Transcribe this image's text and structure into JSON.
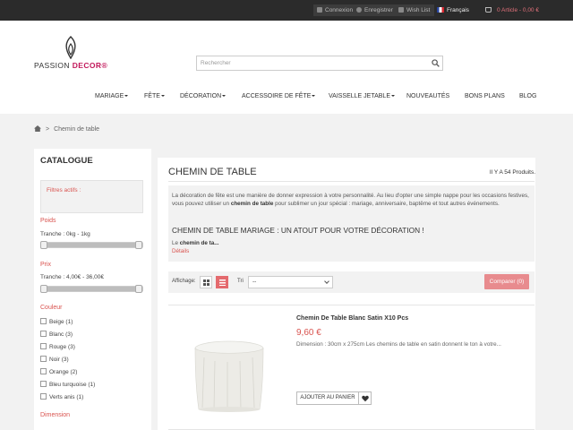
{
  "topbar": {
    "login": "Connexion",
    "register": "Enregistrer",
    "wishlist": "Wish List",
    "language": "Français",
    "cart": "0 Article - 0,00 €"
  },
  "logo": {
    "part1": "PASSION ",
    "part2": "DECOR",
    "mark": "®"
  },
  "search": {
    "placeholder": "Rechercher"
  },
  "nav": {
    "items": [
      {
        "label": "MARIAGE",
        "dropdown": true
      },
      {
        "label": "FÊTE",
        "dropdown": true
      },
      {
        "label": "DÉCORATION",
        "dropdown": true
      },
      {
        "label": "ACCESSOIRE DE FÊTE",
        "dropdown": true
      },
      {
        "label": "VAISSELLE JETABLE",
        "dropdown": true
      },
      {
        "label": "NOUVEAUTÉS",
        "dropdown": false
      },
      {
        "label": "BONS PLANS",
        "dropdown": false
      },
      {
        "label": "BLOG",
        "dropdown": false
      }
    ]
  },
  "breadcrumb": {
    "sep": ">",
    "current": "Chemin de table"
  },
  "sidebar": {
    "title": "CATALOGUE",
    "active_filters": "Filtres actifs :",
    "weight": {
      "label": "Poids",
      "range": "Tranche : 0kg - 1kg"
    },
    "price": {
      "label": "Prix",
      "range": "Tranche : 4,00€ - 36,00€"
    },
    "color": {
      "label": "Couleur",
      "options": [
        "Beige (1)",
        "Blanc (3)",
        "Rouge (3)",
        "Noir (3)",
        "Orange (2)",
        "Bleu turquoise (1)",
        "Verts anis (1)"
      ]
    },
    "dimension": {
      "label": "Dimension"
    }
  },
  "main": {
    "title": "CHEMIN DE TABLE",
    "count": "Il Y A 54 Produits.",
    "desc_p1": "La décoration de fête est une manière de donner expression à votre personnalité. Au lieu d'opter une simple nappe pour les occasions festives, vous pouvez utiliser un ",
    "desc_bold": "chemin de table",
    "desc_p2": " pour sublimer un jour spécial : mariage, anniversaire, baptême et tout autres événements.",
    "desc_h2": "CHEMIN DE TABLE MARIAGE : UN ATOUT POUR VOTRE DÉCORATION !",
    "desc_more_prefix": "Le ",
    "desc_more_bold": "chemin de ta...",
    "details": "Détails"
  },
  "toolbar": {
    "display_label": "Affichage:",
    "sort_label": "Tri",
    "sort_value": "--",
    "compare": "Comparer (0)"
  },
  "product": {
    "name": "Chemin De Table Blanc Satin X10 Pcs",
    "price": "9,60 €",
    "description": "Dimension : 30cm x 275cm Les chemins de table en satin donnent le ton à votre...",
    "add_to_cart": "AJOUTER AU PANIER"
  },
  "colors": {
    "accent": "#d9534f",
    "topbar": "#2b2b2b",
    "brand": "#c2185b",
    "compare": "#e88b8e"
  }
}
